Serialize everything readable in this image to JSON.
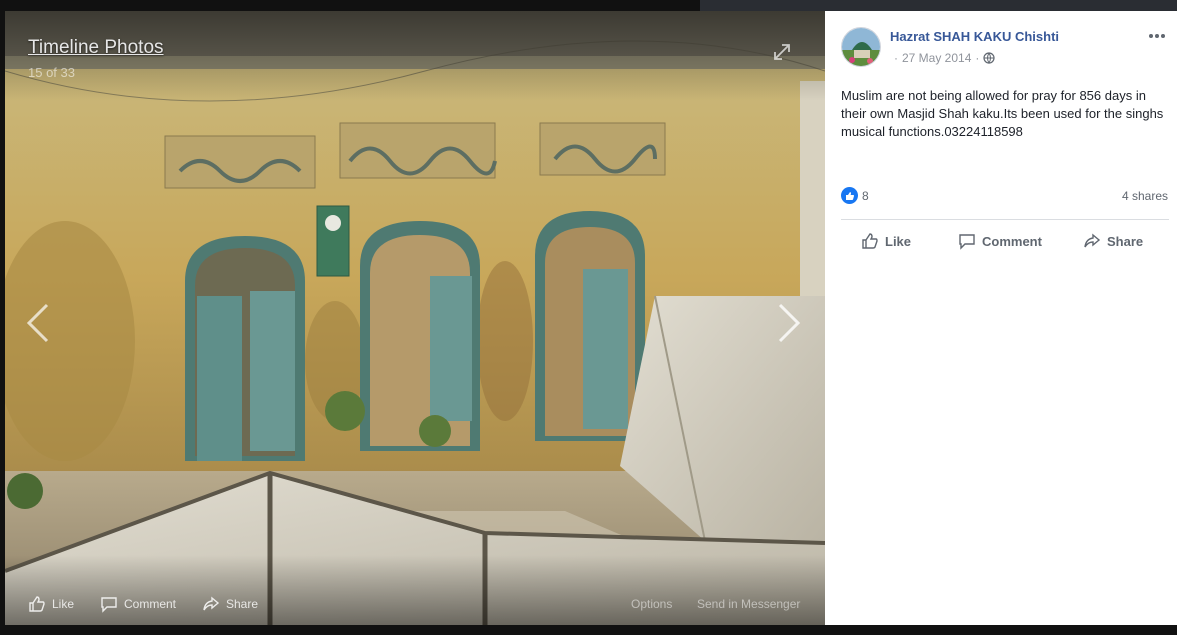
{
  "lightbox": {
    "album_title": "Timeline Photos",
    "photo_counter": "15 of 33",
    "photo_actions": {
      "like": "Like",
      "comment": "Comment",
      "share": "Share",
      "options": "Options",
      "send_in_messenger": "Send in Messenger"
    }
  },
  "post": {
    "author": "Hazrat SHAH KAKU Chishti",
    "date": "27 May 2014",
    "privacy_icon": "globe-icon",
    "text": "Muslim are not being allowed for pray for 856 days in their own Masjid Shah kaku.Its been used for the singhs musical functions.03224118598",
    "reaction_count": "8",
    "shares": "4 shares",
    "actions": {
      "like": "Like",
      "comment": "Comment",
      "share": "Share"
    }
  },
  "colors": {
    "author_link": "#385898",
    "like_blue": "#1877f2",
    "muted_text": "#606770"
  }
}
